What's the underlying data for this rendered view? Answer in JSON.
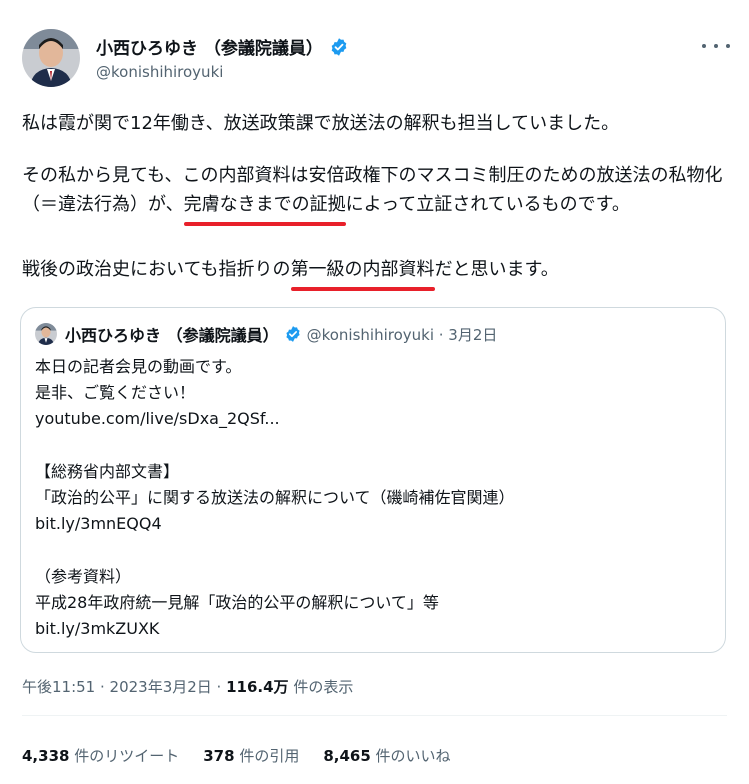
{
  "author": {
    "name": "小西ひろゆき （参議院議員）",
    "handle": "@konishihiroyuki"
  },
  "tweet": {
    "p1": "私は霞が関で12年働き、放送政策課で放送法の解釈も担当していました。",
    "p2_a": "その私から見ても、この内部資料は安倍政権下のマスコミ制圧のための放送法の私物化（＝違法行為）が、",
    "p2_mark": "完膚なきまでの証拠",
    "p2_b": "によって立証されているものです。",
    "p3_a": "戦後の政治史においても指折りの",
    "p3_mark": "第一級の内部資料",
    "p3_b": "だと思います。"
  },
  "quote": {
    "name": "小西ひろゆき （参議院議員）",
    "meta": "@konishihiroyuki · 3月2日",
    "lines": [
      "本日の記者会見の動画です。",
      "是非、ご覧ください！",
      "youtube.com/live/sDxa_2QSf...",
      "",
      "【総務省内部文書】",
      "「政治的公平」に関する放送法の解釈について（磯崎補佐官関連）",
      "bit.ly/3mnEQQ4",
      "",
      "（参考資料）",
      "平成28年政府統一見解「政治的公平の解釈について」等",
      "bit.ly/3mkZUXK"
    ]
  },
  "timestamp": {
    "time": "午後11:51 · 2023年3月2日 · ",
    "views": "116.4万",
    "views_label": " 件の表示"
  },
  "stats": {
    "retweets": "4,338",
    "retweets_label": " 件のリツイート",
    "quotes": "378",
    "quotes_label": " 件の引用",
    "likes": "8,465",
    "likes_label": " 件のいいね"
  },
  "colors": {
    "verified": "#1d9bf0",
    "underline": "#e8202a",
    "secondary_text": "#536471"
  }
}
